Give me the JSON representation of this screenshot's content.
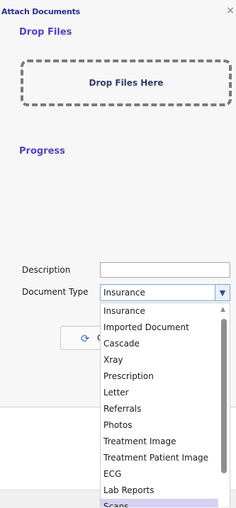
{
  "dialog": {
    "title": "Attach Documents",
    "close_symbol": "×"
  },
  "drop_section": {
    "title": "Drop Files",
    "zone_text": "Drop Files Here"
  },
  "progress_section": {
    "title": "Progress"
  },
  "form": {
    "description_label": "Description",
    "description_value": "",
    "document_type_label": "Document Type",
    "document_type_value": "Insurance"
  },
  "upload_button": {
    "label_partial": "C",
    "icon": "upload-icon"
  },
  "dropdown": {
    "options": [
      "Insurance",
      "Imported Document",
      "Cascade",
      "Xray",
      "Prescription",
      "Letter",
      "Referrals",
      "Photos",
      "Treatment Image",
      "Treatment Patient Image",
      "ECG",
      "Lab Reports",
      "Scans"
    ],
    "highlighted_index": 12
  },
  "colors": {
    "title": "#2a2d8f",
    "section_title": "#5a3fc0",
    "highlight": "#d6d3f2"
  }
}
